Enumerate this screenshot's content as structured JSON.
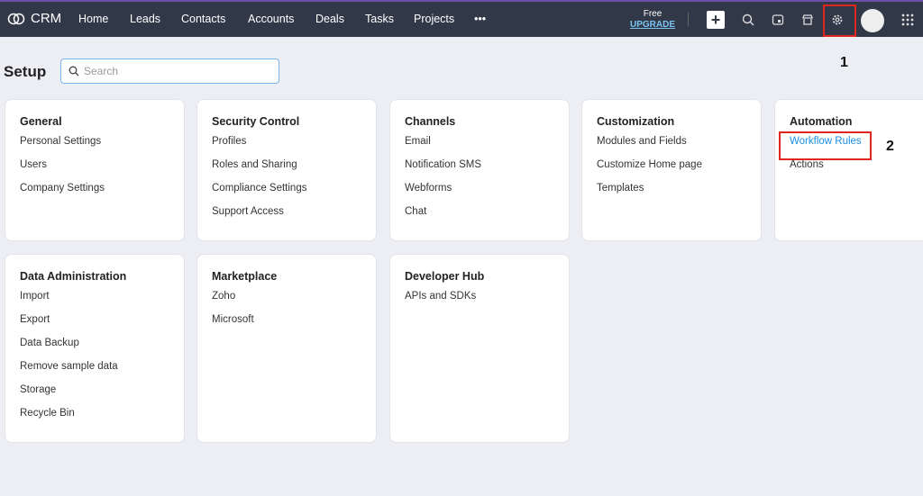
{
  "nav": {
    "brand": "CRM",
    "items": [
      "Home",
      "Leads",
      "Contacts",
      "Accounts",
      "Deals",
      "Tasks",
      "Projects",
      "•••"
    ],
    "free": "Free",
    "upgrade": "UPGRADE"
  },
  "page": {
    "title": "Setup",
    "search_placeholder": "Search"
  },
  "annotations": [
    "1",
    "2"
  ],
  "cards": [
    {
      "title": "General",
      "items": [
        "Personal Settings",
        "Users",
        "Company Settings"
      ]
    },
    {
      "title": "Security Control",
      "items": [
        "Profiles",
        "Roles and Sharing",
        "Compliance Settings",
        "Support Access"
      ]
    },
    {
      "title": "Channels",
      "items": [
        "Email",
        "Notification SMS",
        "Webforms",
        "Chat"
      ]
    },
    {
      "title": "Customization",
      "items": [
        "Modules and Fields",
        "Customize Home page",
        "Templates"
      ]
    },
    {
      "title": "Automation",
      "items": [
        "Workflow Rules",
        "Actions"
      ]
    },
    {
      "title": "Data Administration",
      "items": [
        "Import",
        "Export",
        "Data Backup",
        "Remove sample data",
        "Storage",
        "Recycle Bin"
      ]
    },
    {
      "title": "Marketplace",
      "items": [
        "Zoho",
        "Microsoft"
      ]
    },
    {
      "title": "Developer Hub",
      "items": [
        "APIs and SDKs"
      ]
    }
  ]
}
